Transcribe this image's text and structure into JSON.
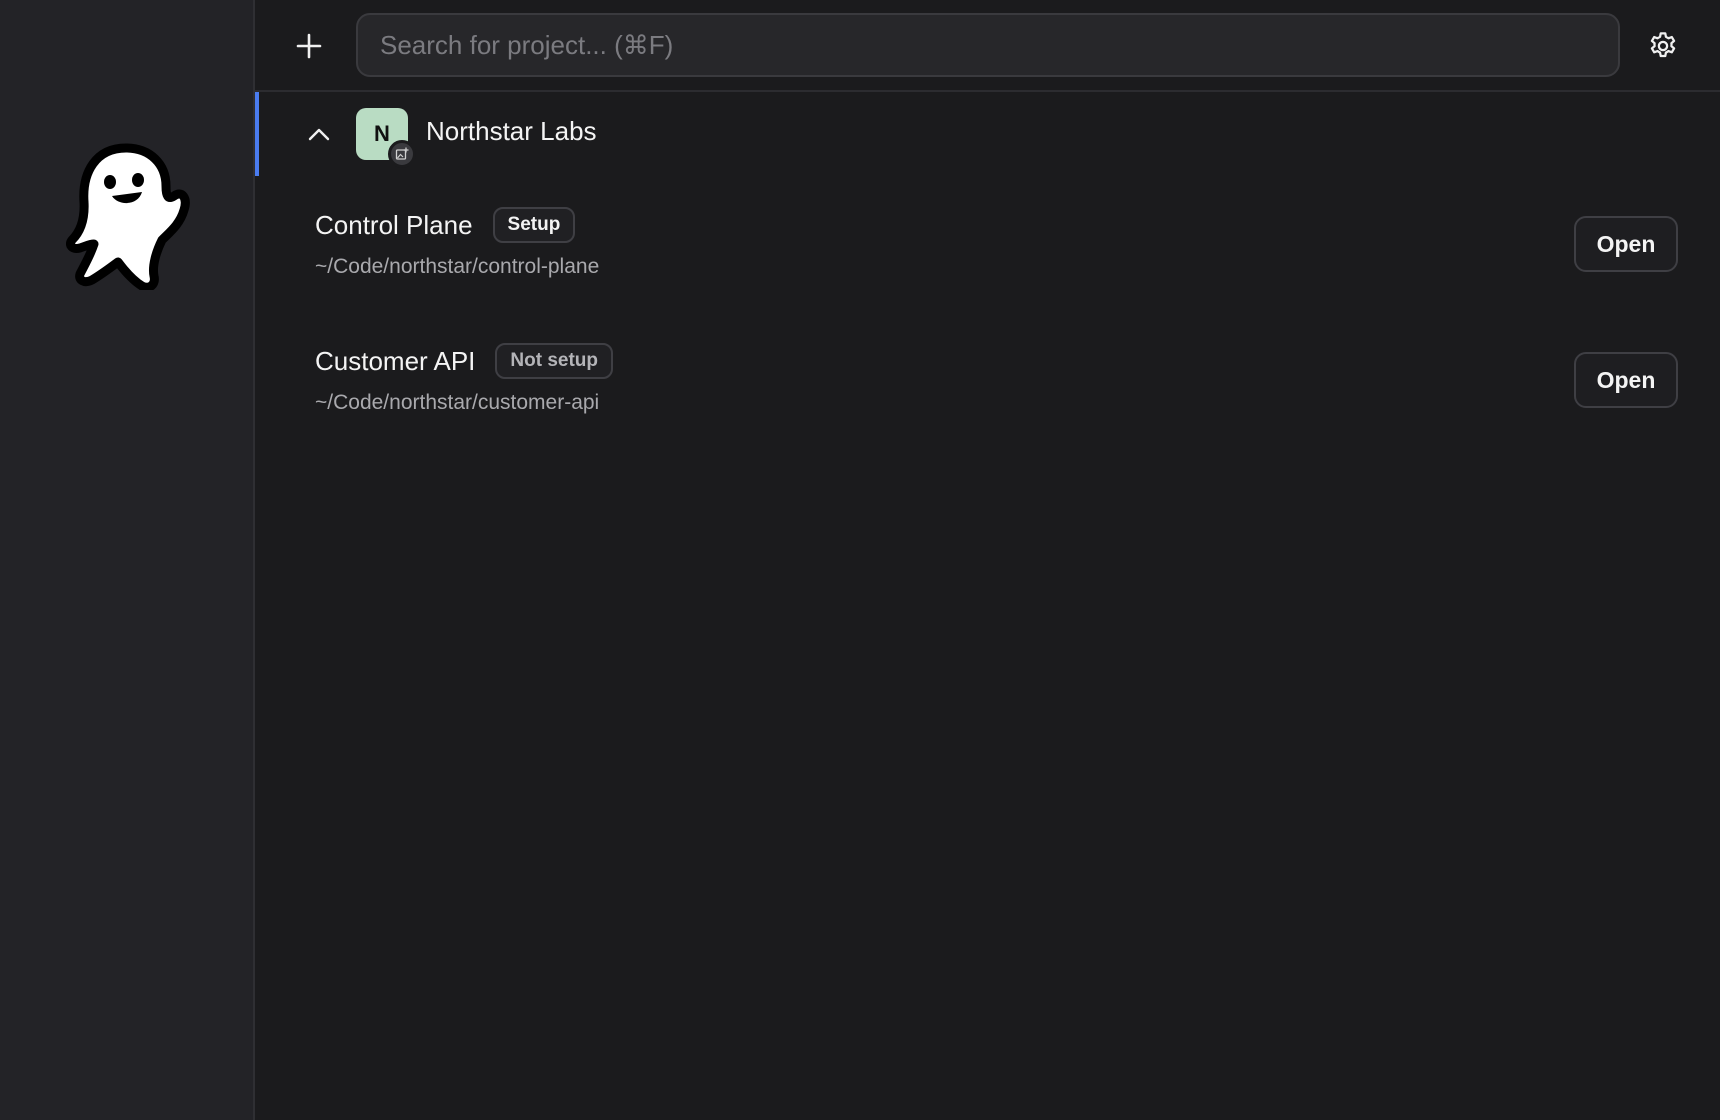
{
  "search": {
    "placeholder": "Search for project... (⌘F)",
    "value": ""
  },
  "icons": {
    "logo": "ghost-icon",
    "add": "plus-icon",
    "settings": "gear-icon",
    "collapse": "chevron-up-icon",
    "avatar_edit": "edit-image-icon"
  },
  "colors": {
    "sidebar_bg": "#232327",
    "main_bg": "#1b1b1d",
    "accent": "#4a7cf0",
    "avatar_bg": "#b9dcc3"
  },
  "group": {
    "avatar_letter": "N",
    "name": "Northstar Labs",
    "expanded": true
  },
  "projects": [
    {
      "name": "Control Plane",
      "status": "Setup",
      "path": "~/Code/northstar/control-plane",
      "action_label": "Open"
    },
    {
      "name": "Customer API",
      "status": "Not setup",
      "path": "~/Code/northstar/customer-api",
      "action_label": "Open"
    }
  ]
}
